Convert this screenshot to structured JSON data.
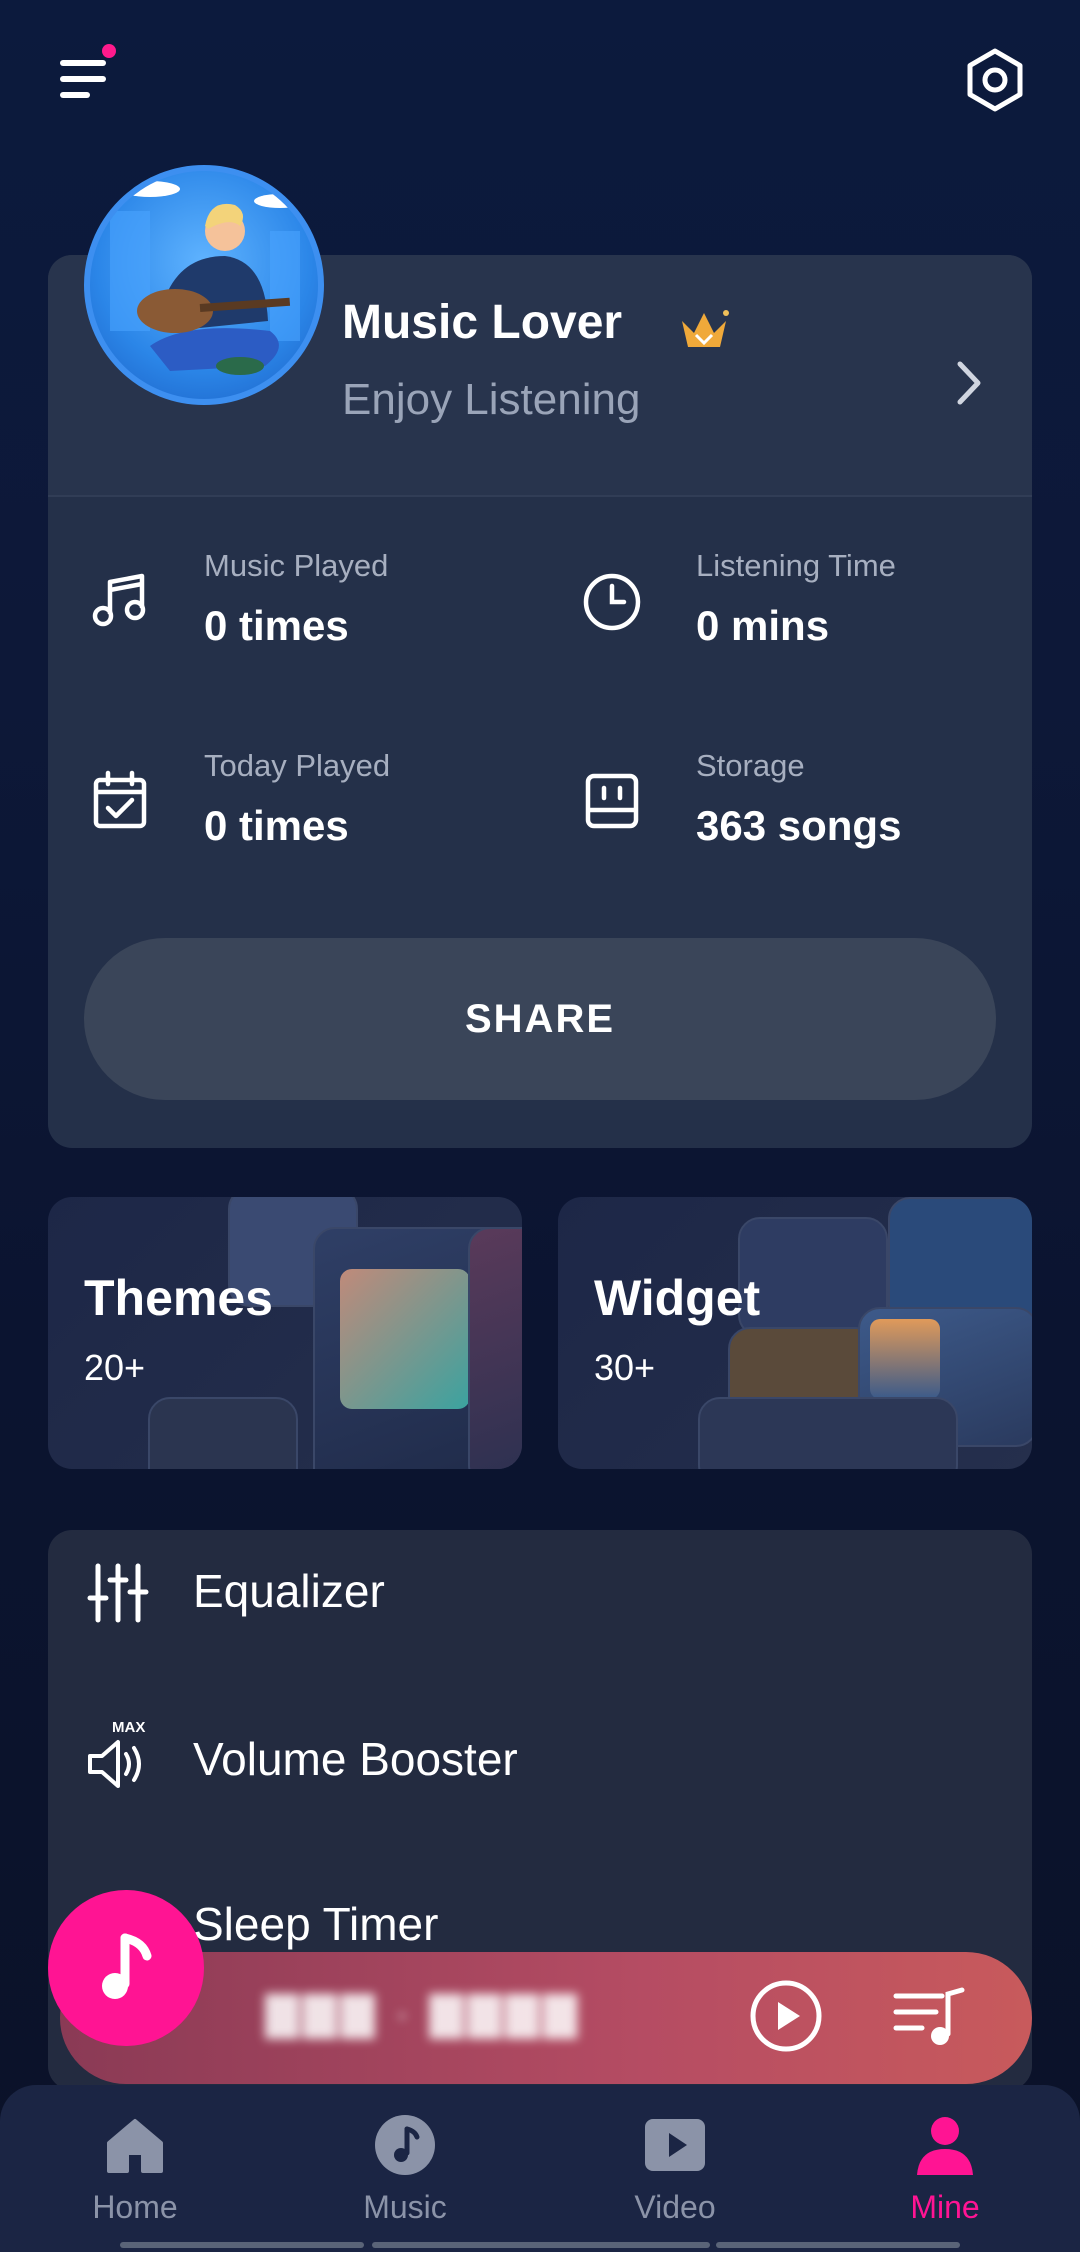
{
  "header": {
    "menu_icon": "menu-icon",
    "settings_icon": "hexagon-settings-icon"
  },
  "profile": {
    "name": "Music Lover",
    "subtitle": "Enjoy Listening",
    "badge_icon": "crown-icon"
  },
  "stats": [
    {
      "icon": "music-note-icon",
      "label": "Music Played",
      "value": "0 times"
    },
    {
      "icon": "clock-icon",
      "label": "Listening Time",
      "value": "0 mins"
    },
    {
      "icon": "calendar-check-icon",
      "label": "Today Played",
      "value": "0 times"
    },
    {
      "icon": "storage-icon",
      "label": "Storage",
      "value": "363 songs"
    }
  ],
  "share_label": "SHARE",
  "features": [
    {
      "title": "Themes",
      "count": "20+"
    },
    {
      "title": "Widget",
      "count": "30+"
    }
  ],
  "tools": [
    {
      "icon": "equalizer-icon",
      "label": "Equalizer"
    },
    {
      "icon": "volume-booster-icon",
      "label": "Volume Booster",
      "icon_text": "MAX"
    },
    {
      "icon": "alarm-clock-icon",
      "label": "Sleep Timer"
    }
  ],
  "player": {
    "song_title": "▇▇▇ · ▇▇▇▇",
    "play_icon": "play-icon",
    "queue_icon": "queue-music-icon"
  },
  "nav": [
    {
      "label": "Home",
      "icon": "home-icon"
    },
    {
      "label": "Music",
      "icon": "music-disc-icon"
    },
    {
      "label": "Video",
      "icon": "video-icon"
    },
    {
      "label": "Mine",
      "icon": "person-icon",
      "active": true
    }
  ],
  "colors": {
    "accent": "#ff1493",
    "card": "#243049",
    "background": "#0c1a3d"
  }
}
